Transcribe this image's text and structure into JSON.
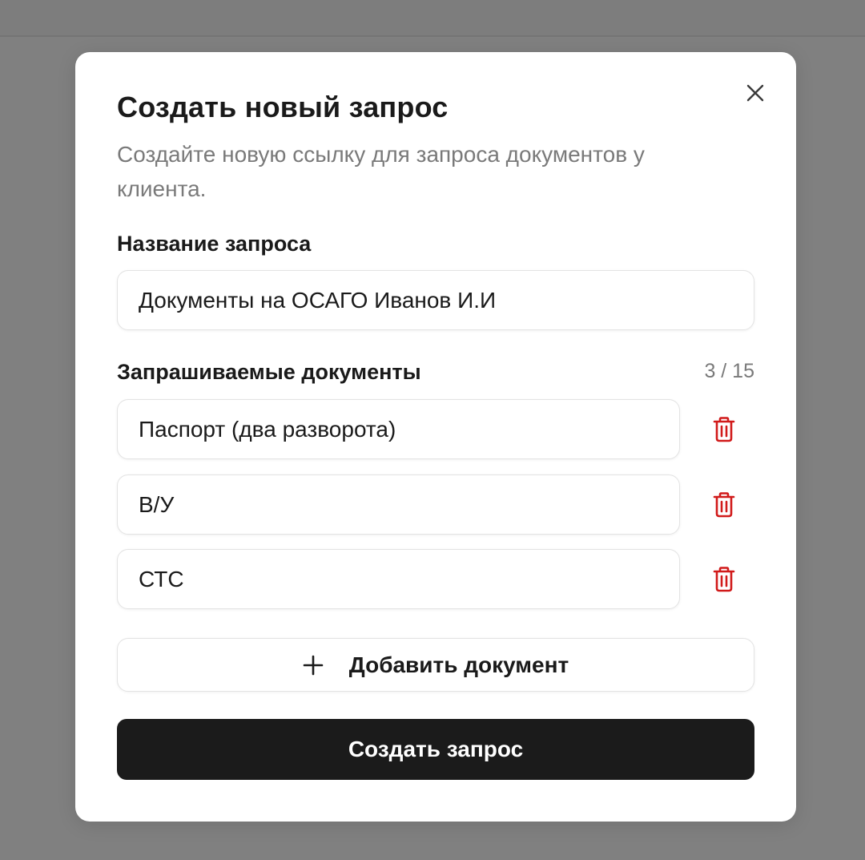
{
  "dialog": {
    "title": "Создать новый запрос",
    "subtitle": "Создайте новую ссылку для запроса документов у клиента.",
    "close_icon": "close-icon"
  },
  "request_name": {
    "label": "Название запроса",
    "value": "Документы на ОСАГО Иванов И.И"
  },
  "documents": {
    "label": "Запрашиваемые документы",
    "counter": "3 / 15",
    "items": [
      {
        "value": "Паспорт (два разворота)",
        "delete_icon": "trash-icon"
      },
      {
        "value": "В/У",
        "delete_icon": "trash-icon"
      },
      {
        "value": "СТС",
        "delete_icon": "trash-icon"
      }
    ],
    "add_label": "Добавить документ",
    "add_icon": "plus-icon"
  },
  "submit_label": "Создать запрос",
  "colors": {
    "overlay": "#808080",
    "delete_icon": "#d11a1a",
    "primary_button": "#1b1b1b",
    "muted_text": "#7a7a7a"
  }
}
